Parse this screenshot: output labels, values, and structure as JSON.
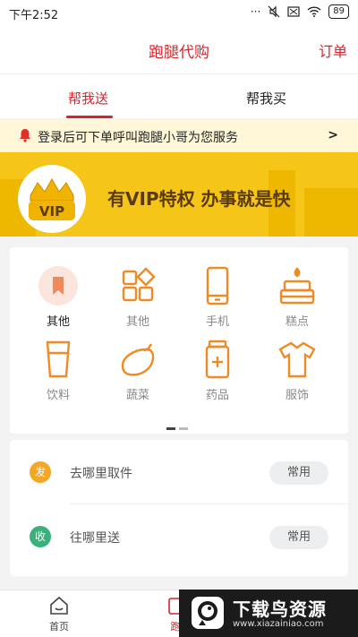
{
  "status": {
    "time": "下午2:52",
    "battery": "89"
  },
  "header": {
    "title": "跑腿代购",
    "orders_label": "订单"
  },
  "tabs": [
    {
      "label": "帮我送"
    },
    {
      "label": "帮我买"
    }
  ],
  "notice": {
    "text": "登录后可下单呼叫跑腿小哥为您服务",
    "arrow": ">"
  },
  "vip_banner": {
    "badge_text": "VIP",
    "slogan": "有VIP特权 办事就是快"
  },
  "categories": [
    {
      "label": "其他",
      "icon": "bookmark-icon",
      "active": true
    },
    {
      "label": "其他",
      "icon": "grid-icon"
    },
    {
      "label": "手机",
      "icon": "phone-icon"
    },
    {
      "label": "糕点",
      "icon": "cake-icon"
    },
    {
      "label": "饮料",
      "icon": "drink-icon"
    },
    {
      "label": "蔬菜",
      "icon": "eggplant-icon"
    },
    {
      "label": "药品",
      "icon": "medicine-icon"
    },
    {
      "label": "服饰",
      "icon": "shirt-icon"
    }
  ],
  "address": {
    "pickup": {
      "badge": "发",
      "placeholder": "去哪里取件",
      "button": "常用",
      "color": "#f5a623"
    },
    "delivery": {
      "badge": "收",
      "placeholder": "往哪里送",
      "button": "常用",
      "color": "#3ab07a"
    }
  },
  "bottom_nav": [
    {
      "label": "首页"
    },
    {
      "label": "跑"
    }
  ],
  "watermark": {
    "title": "下载鸟资源",
    "url": "www.xiazainiao.com"
  },
  "colors": {
    "accent": "#d8232a",
    "icon_orange": "#f08a24",
    "banner": "#f5c518"
  }
}
